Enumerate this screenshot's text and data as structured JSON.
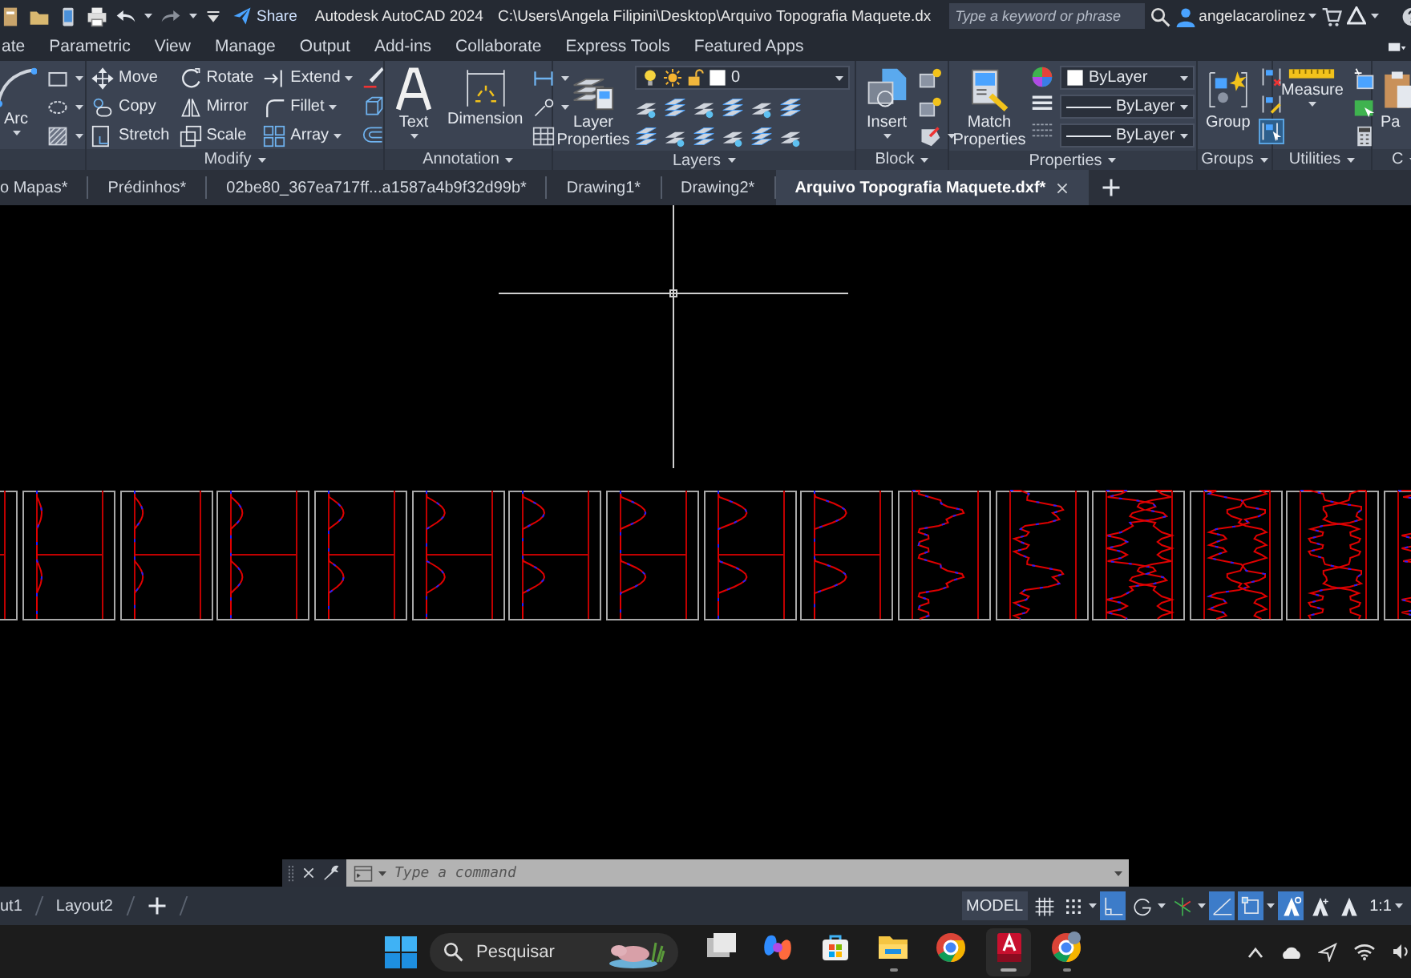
{
  "title_bar": {
    "share": "Share",
    "app_title": "Autodesk AutoCAD 2024",
    "file_path": "C:\\Users\\Angela Filipini\\Desktop\\Arquivo Topografia Maquete.dx",
    "search_placeholder": "Type a keyword or phrase",
    "user": "angelacarolinez"
  },
  "ribbon_tabs": [
    "ate",
    "Parametric",
    "View",
    "Manage",
    "Output",
    "Add-ins",
    "Collaborate",
    "Express Tools",
    "Featured Apps"
  ],
  "ribbon": {
    "draw": {
      "large": "Arc"
    },
    "modify": {
      "title": "Modify",
      "tools": [
        {
          "label": "Move",
          "dropdown": false
        },
        {
          "label": "Rotate",
          "dropdown": false
        },
        {
          "label": "Extend",
          "dropdown": true
        },
        {
          "label": "Copy",
          "dropdown": false
        },
        {
          "label": "Mirror",
          "dropdown": false
        },
        {
          "label": "Fillet",
          "dropdown": true
        },
        {
          "label": "Stretch",
          "dropdown": false
        },
        {
          "label": "Scale",
          "dropdown": false
        },
        {
          "label": "Array",
          "dropdown": true
        }
      ]
    },
    "annotation": {
      "title": "Annotation",
      "large": [
        "Text",
        "Dimension"
      ]
    },
    "layers": {
      "title": "Layers",
      "large": "Layer Properties",
      "current_layer": "0"
    },
    "block": {
      "title": "Block",
      "large": "Insert"
    },
    "properties": {
      "title": "Properties",
      "large": "Match Properties",
      "color_setting": "ByLayer",
      "lineweight_setting": "ByLayer",
      "linetype_setting": "ByLayer"
    },
    "groups": {
      "title": "Groups",
      "large": "Group",
      "tools": [
        {
          "on": false
        },
        {
          "on": false
        },
        {
          "on": true
        }
      ]
    },
    "utilities": {
      "title": "Utilities",
      "large": "Measure"
    },
    "clipboard": {
      "title": "C",
      "large": "Pa"
    }
  },
  "doc_tabs": [
    {
      "label": "o Mapas*",
      "selected": false
    },
    {
      "label": "Prédinhos*",
      "selected": false
    },
    {
      "label": "02be80_367ea717ff...a1587a4b9f32d99b*",
      "selected": false
    },
    {
      "label": "Drawing1*",
      "selected": false
    },
    {
      "label": "Drawing2*",
      "selected": false
    },
    {
      "label": "Arquivo Topografia Maquete.dxf*",
      "selected": true
    }
  ],
  "command_line": {
    "placeholder": "Type a command"
  },
  "layout_tabs": [
    "ut1",
    "Layout2"
  ],
  "status_bar": {
    "model": "MODEL",
    "scale": "1:1",
    "toggles": [
      {
        "kind": "grid",
        "on": false
      },
      {
        "kind": "snap",
        "on": false,
        "dropdown": true
      },
      {
        "kind": "ortho",
        "on": true
      },
      {
        "kind": "polar",
        "on": false,
        "dropdown": true
      },
      {
        "kind": "isodraft",
        "on": false,
        "dropdown": true
      },
      {
        "kind": "track",
        "on": true
      },
      {
        "kind": "osnap",
        "on": true,
        "dropdown": true
      },
      {
        "kind": "annovis",
        "on": true
      },
      {
        "kind": "autoscale",
        "on": false
      },
      {
        "kind": "annoscale",
        "on": false
      }
    ]
  },
  "taskbar": {
    "search_placeholder": "Pesquisar",
    "apps": [
      {
        "kind": "task-view",
        "running": false,
        "active": false
      },
      {
        "kind": "copilot",
        "running": false,
        "active": false
      },
      {
        "kind": "store",
        "running": false,
        "active": false
      },
      {
        "kind": "files",
        "running": true,
        "active": false
      },
      {
        "kind": "chrome",
        "running": false,
        "active": false
      },
      {
        "kind": "autocad",
        "running": true,
        "active": true
      },
      {
        "kind": "chrome",
        "running": true,
        "active": false
      }
    ]
  }
}
